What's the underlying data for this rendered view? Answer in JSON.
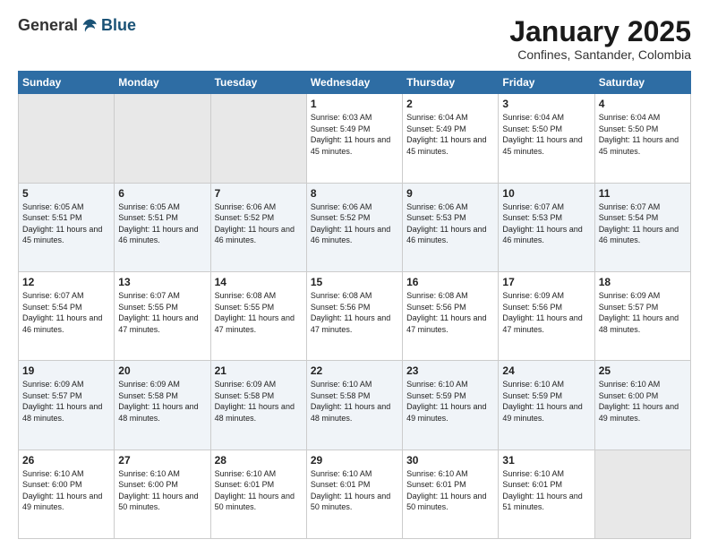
{
  "logo": {
    "general": "General",
    "blue": "Blue"
  },
  "header": {
    "title": "January 2025",
    "subtitle": "Confines, Santander, Colombia"
  },
  "weekdays": [
    "Sunday",
    "Monday",
    "Tuesday",
    "Wednesday",
    "Thursday",
    "Friday",
    "Saturday"
  ],
  "weeks": [
    [
      {
        "day": "",
        "empty": true
      },
      {
        "day": "",
        "empty": true
      },
      {
        "day": "",
        "empty": true
      },
      {
        "day": "1",
        "sunrise": "6:03 AM",
        "sunset": "5:49 PM",
        "daylight": "11 hours and 45 minutes."
      },
      {
        "day": "2",
        "sunrise": "6:04 AM",
        "sunset": "5:49 PM",
        "daylight": "11 hours and 45 minutes."
      },
      {
        "day": "3",
        "sunrise": "6:04 AM",
        "sunset": "5:50 PM",
        "daylight": "11 hours and 45 minutes."
      },
      {
        "day": "4",
        "sunrise": "6:04 AM",
        "sunset": "5:50 PM",
        "daylight": "11 hours and 45 minutes."
      }
    ],
    [
      {
        "day": "5",
        "sunrise": "6:05 AM",
        "sunset": "5:51 PM",
        "daylight": "11 hours and 45 minutes."
      },
      {
        "day": "6",
        "sunrise": "6:05 AM",
        "sunset": "5:51 PM",
        "daylight": "11 hours and 46 minutes."
      },
      {
        "day": "7",
        "sunrise": "6:06 AM",
        "sunset": "5:52 PM",
        "daylight": "11 hours and 46 minutes."
      },
      {
        "day": "8",
        "sunrise": "6:06 AM",
        "sunset": "5:52 PM",
        "daylight": "11 hours and 46 minutes."
      },
      {
        "day": "9",
        "sunrise": "6:06 AM",
        "sunset": "5:53 PM",
        "daylight": "11 hours and 46 minutes."
      },
      {
        "day": "10",
        "sunrise": "6:07 AM",
        "sunset": "5:53 PM",
        "daylight": "11 hours and 46 minutes."
      },
      {
        "day": "11",
        "sunrise": "6:07 AM",
        "sunset": "5:54 PM",
        "daylight": "11 hours and 46 minutes."
      }
    ],
    [
      {
        "day": "12",
        "sunrise": "6:07 AM",
        "sunset": "5:54 PM",
        "daylight": "11 hours and 46 minutes."
      },
      {
        "day": "13",
        "sunrise": "6:07 AM",
        "sunset": "5:55 PM",
        "daylight": "11 hours and 47 minutes."
      },
      {
        "day": "14",
        "sunrise": "6:08 AM",
        "sunset": "5:55 PM",
        "daylight": "11 hours and 47 minutes."
      },
      {
        "day": "15",
        "sunrise": "6:08 AM",
        "sunset": "5:56 PM",
        "daylight": "11 hours and 47 minutes."
      },
      {
        "day": "16",
        "sunrise": "6:08 AM",
        "sunset": "5:56 PM",
        "daylight": "11 hours and 47 minutes."
      },
      {
        "day": "17",
        "sunrise": "6:09 AM",
        "sunset": "5:56 PM",
        "daylight": "11 hours and 47 minutes."
      },
      {
        "day": "18",
        "sunrise": "6:09 AM",
        "sunset": "5:57 PM",
        "daylight": "11 hours and 48 minutes."
      }
    ],
    [
      {
        "day": "19",
        "sunrise": "6:09 AM",
        "sunset": "5:57 PM",
        "daylight": "11 hours and 48 minutes."
      },
      {
        "day": "20",
        "sunrise": "6:09 AM",
        "sunset": "5:58 PM",
        "daylight": "11 hours and 48 minutes."
      },
      {
        "day": "21",
        "sunrise": "6:09 AM",
        "sunset": "5:58 PM",
        "daylight": "11 hours and 48 minutes."
      },
      {
        "day": "22",
        "sunrise": "6:10 AM",
        "sunset": "5:58 PM",
        "daylight": "11 hours and 48 minutes."
      },
      {
        "day": "23",
        "sunrise": "6:10 AM",
        "sunset": "5:59 PM",
        "daylight": "11 hours and 49 minutes."
      },
      {
        "day": "24",
        "sunrise": "6:10 AM",
        "sunset": "5:59 PM",
        "daylight": "11 hours and 49 minutes."
      },
      {
        "day": "25",
        "sunrise": "6:10 AM",
        "sunset": "6:00 PM",
        "daylight": "11 hours and 49 minutes."
      }
    ],
    [
      {
        "day": "26",
        "sunrise": "6:10 AM",
        "sunset": "6:00 PM",
        "daylight": "11 hours and 49 minutes."
      },
      {
        "day": "27",
        "sunrise": "6:10 AM",
        "sunset": "6:00 PM",
        "daylight": "11 hours and 50 minutes."
      },
      {
        "day": "28",
        "sunrise": "6:10 AM",
        "sunset": "6:01 PM",
        "daylight": "11 hours and 50 minutes."
      },
      {
        "day": "29",
        "sunrise": "6:10 AM",
        "sunset": "6:01 PM",
        "daylight": "11 hours and 50 minutes."
      },
      {
        "day": "30",
        "sunrise": "6:10 AM",
        "sunset": "6:01 PM",
        "daylight": "11 hours and 50 minutes."
      },
      {
        "day": "31",
        "sunrise": "6:10 AM",
        "sunset": "6:01 PM",
        "daylight": "11 hours and 51 minutes."
      },
      {
        "day": "",
        "empty": true
      }
    ]
  ],
  "labels": {
    "sunrise": "Sunrise:",
    "sunset": "Sunset:",
    "daylight": "Daylight:"
  }
}
